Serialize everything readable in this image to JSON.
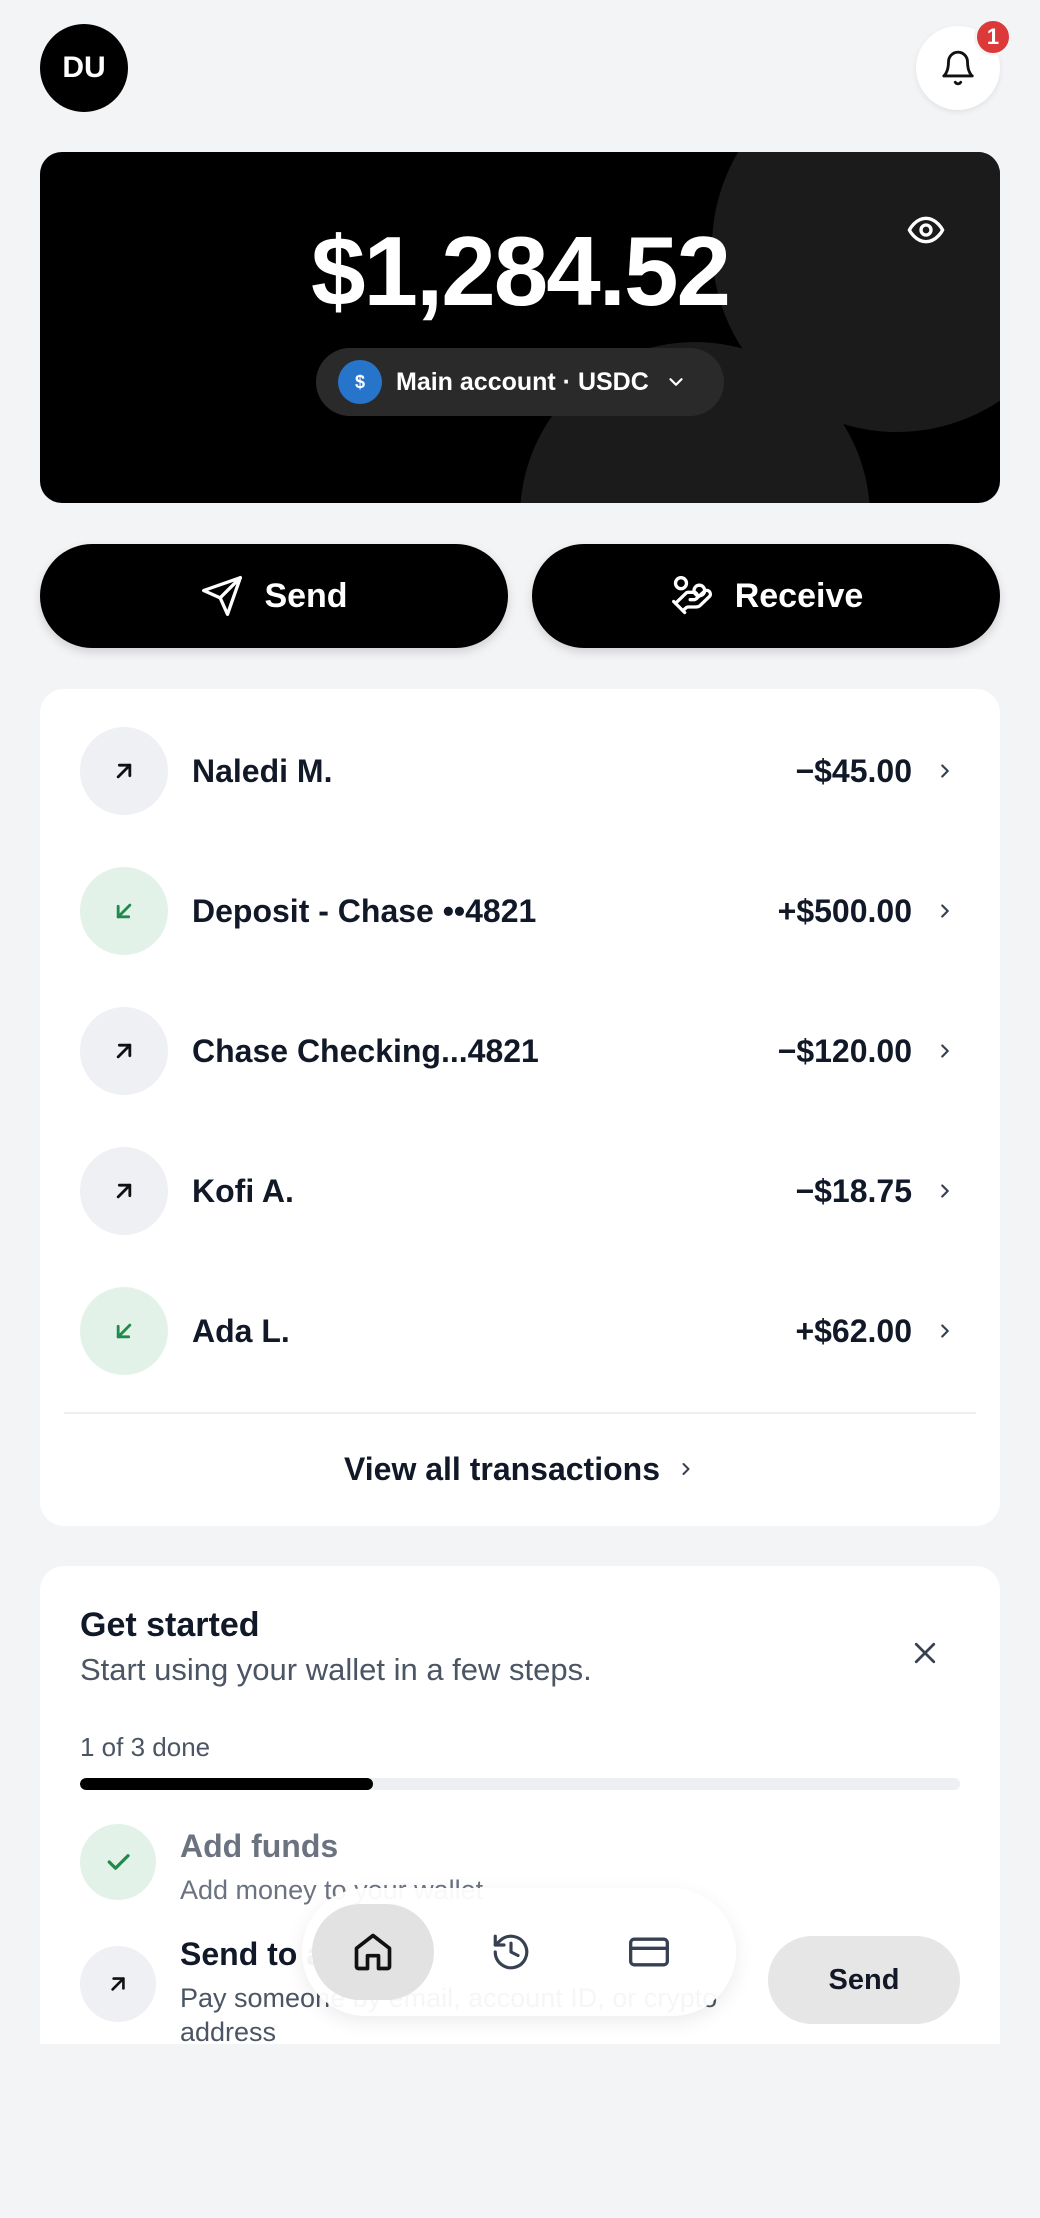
{
  "header": {
    "avatar_initials": "DU",
    "notification_count": "1"
  },
  "balance": {
    "amount": "$1,284.52",
    "account_icon": "$",
    "account_label": "Main account · USDC"
  },
  "actions": {
    "send_label": "Send",
    "receive_label": "Receive"
  },
  "transactions": [
    {
      "name": "Naledi M.",
      "amount": "−$45.00",
      "direction": "out"
    },
    {
      "name": "Deposit - Chase ••4821",
      "amount": "+$500.00",
      "direction": "in"
    },
    {
      "name": "Chase Checking...4821",
      "amount": "−$120.00",
      "direction": "out"
    },
    {
      "name": "Kofi A.",
      "amount": "−$18.75",
      "direction": "out"
    },
    {
      "name": "Ada L.",
      "amount": "+$62.00",
      "direction": "in"
    }
  ],
  "view_all_label": "View all transactions",
  "get_started": {
    "title": "Get started",
    "subtitle": "Start using your wallet in a few steps.",
    "progress_label": "1 of 3 done",
    "progress_fraction": 0.333,
    "steps": [
      {
        "title": "Add funds",
        "description": "Add money to your wallet",
        "done": true
      },
      {
        "title": "Send to a friend",
        "description": "Pay someone by email, account ID, or crypto address",
        "done": false,
        "button_label": "Send"
      }
    ]
  },
  "nav": {
    "items": [
      "home-icon",
      "history-icon",
      "card-icon"
    ],
    "active": "home-icon"
  },
  "colors": {
    "badge": "#dc3a3a",
    "usdc": "#2775ca",
    "incoming": "#1f8a4c"
  }
}
